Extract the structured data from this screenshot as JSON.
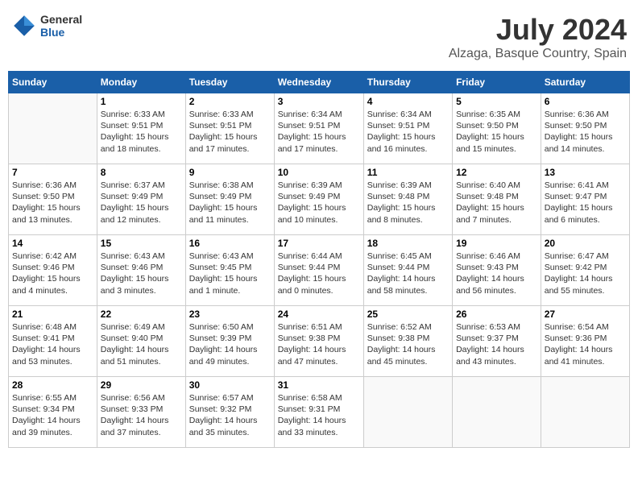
{
  "header": {
    "logo_general": "General",
    "logo_blue": "Blue",
    "month_title": "July 2024",
    "location": "Alzaga, Basque Country, Spain"
  },
  "weekdays": [
    "Sunday",
    "Monday",
    "Tuesday",
    "Wednesday",
    "Thursday",
    "Friday",
    "Saturday"
  ],
  "weeks": [
    [
      {
        "day": "",
        "info": ""
      },
      {
        "day": "1",
        "info": "Sunrise: 6:33 AM\nSunset: 9:51 PM\nDaylight: 15 hours\nand 18 minutes."
      },
      {
        "day": "2",
        "info": "Sunrise: 6:33 AM\nSunset: 9:51 PM\nDaylight: 15 hours\nand 17 minutes."
      },
      {
        "day": "3",
        "info": "Sunrise: 6:34 AM\nSunset: 9:51 PM\nDaylight: 15 hours\nand 17 minutes."
      },
      {
        "day": "4",
        "info": "Sunrise: 6:34 AM\nSunset: 9:51 PM\nDaylight: 15 hours\nand 16 minutes."
      },
      {
        "day": "5",
        "info": "Sunrise: 6:35 AM\nSunset: 9:50 PM\nDaylight: 15 hours\nand 15 minutes."
      },
      {
        "day": "6",
        "info": "Sunrise: 6:36 AM\nSunset: 9:50 PM\nDaylight: 15 hours\nand 14 minutes."
      }
    ],
    [
      {
        "day": "7",
        "info": "Sunrise: 6:36 AM\nSunset: 9:50 PM\nDaylight: 15 hours\nand 13 minutes."
      },
      {
        "day": "8",
        "info": "Sunrise: 6:37 AM\nSunset: 9:49 PM\nDaylight: 15 hours\nand 12 minutes."
      },
      {
        "day": "9",
        "info": "Sunrise: 6:38 AM\nSunset: 9:49 PM\nDaylight: 15 hours\nand 11 minutes."
      },
      {
        "day": "10",
        "info": "Sunrise: 6:39 AM\nSunset: 9:49 PM\nDaylight: 15 hours\nand 10 minutes."
      },
      {
        "day": "11",
        "info": "Sunrise: 6:39 AM\nSunset: 9:48 PM\nDaylight: 15 hours\nand 8 minutes."
      },
      {
        "day": "12",
        "info": "Sunrise: 6:40 AM\nSunset: 9:48 PM\nDaylight: 15 hours\nand 7 minutes."
      },
      {
        "day": "13",
        "info": "Sunrise: 6:41 AM\nSunset: 9:47 PM\nDaylight: 15 hours\nand 6 minutes."
      }
    ],
    [
      {
        "day": "14",
        "info": "Sunrise: 6:42 AM\nSunset: 9:46 PM\nDaylight: 15 hours\nand 4 minutes."
      },
      {
        "day": "15",
        "info": "Sunrise: 6:43 AM\nSunset: 9:46 PM\nDaylight: 15 hours\nand 3 minutes."
      },
      {
        "day": "16",
        "info": "Sunrise: 6:43 AM\nSunset: 9:45 PM\nDaylight: 15 hours\nand 1 minute."
      },
      {
        "day": "17",
        "info": "Sunrise: 6:44 AM\nSunset: 9:44 PM\nDaylight: 15 hours\nand 0 minutes."
      },
      {
        "day": "18",
        "info": "Sunrise: 6:45 AM\nSunset: 9:44 PM\nDaylight: 14 hours\nand 58 minutes."
      },
      {
        "day": "19",
        "info": "Sunrise: 6:46 AM\nSunset: 9:43 PM\nDaylight: 14 hours\nand 56 minutes."
      },
      {
        "day": "20",
        "info": "Sunrise: 6:47 AM\nSunset: 9:42 PM\nDaylight: 14 hours\nand 55 minutes."
      }
    ],
    [
      {
        "day": "21",
        "info": "Sunrise: 6:48 AM\nSunset: 9:41 PM\nDaylight: 14 hours\nand 53 minutes."
      },
      {
        "day": "22",
        "info": "Sunrise: 6:49 AM\nSunset: 9:40 PM\nDaylight: 14 hours\nand 51 minutes."
      },
      {
        "day": "23",
        "info": "Sunrise: 6:50 AM\nSunset: 9:39 PM\nDaylight: 14 hours\nand 49 minutes."
      },
      {
        "day": "24",
        "info": "Sunrise: 6:51 AM\nSunset: 9:38 PM\nDaylight: 14 hours\nand 47 minutes."
      },
      {
        "day": "25",
        "info": "Sunrise: 6:52 AM\nSunset: 9:38 PM\nDaylight: 14 hours\nand 45 minutes."
      },
      {
        "day": "26",
        "info": "Sunrise: 6:53 AM\nSunset: 9:37 PM\nDaylight: 14 hours\nand 43 minutes."
      },
      {
        "day": "27",
        "info": "Sunrise: 6:54 AM\nSunset: 9:36 PM\nDaylight: 14 hours\nand 41 minutes."
      }
    ],
    [
      {
        "day": "28",
        "info": "Sunrise: 6:55 AM\nSunset: 9:34 PM\nDaylight: 14 hours\nand 39 minutes."
      },
      {
        "day": "29",
        "info": "Sunrise: 6:56 AM\nSunset: 9:33 PM\nDaylight: 14 hours\nand 37 minutes."
      },
      {
        "day": "30",
        "info": "Sunrise: 6:57 AM\nSunset: 9:32 PM\nDaylight: 14 hours\nand 35 minutes."
      },
      {
        "day": "31",
        "info": "Sunrise: 6:58 AM\nSunset: 9:31 PM\nDaylight: 14 hours\nand 33 minutes."
      },
      {
        "day": "",
        "info": ""
      },
      {
        "day": "",
        "info": ""
      },
      {
        "day": "",
        "info": ""
      }
    ]
  ]
}
